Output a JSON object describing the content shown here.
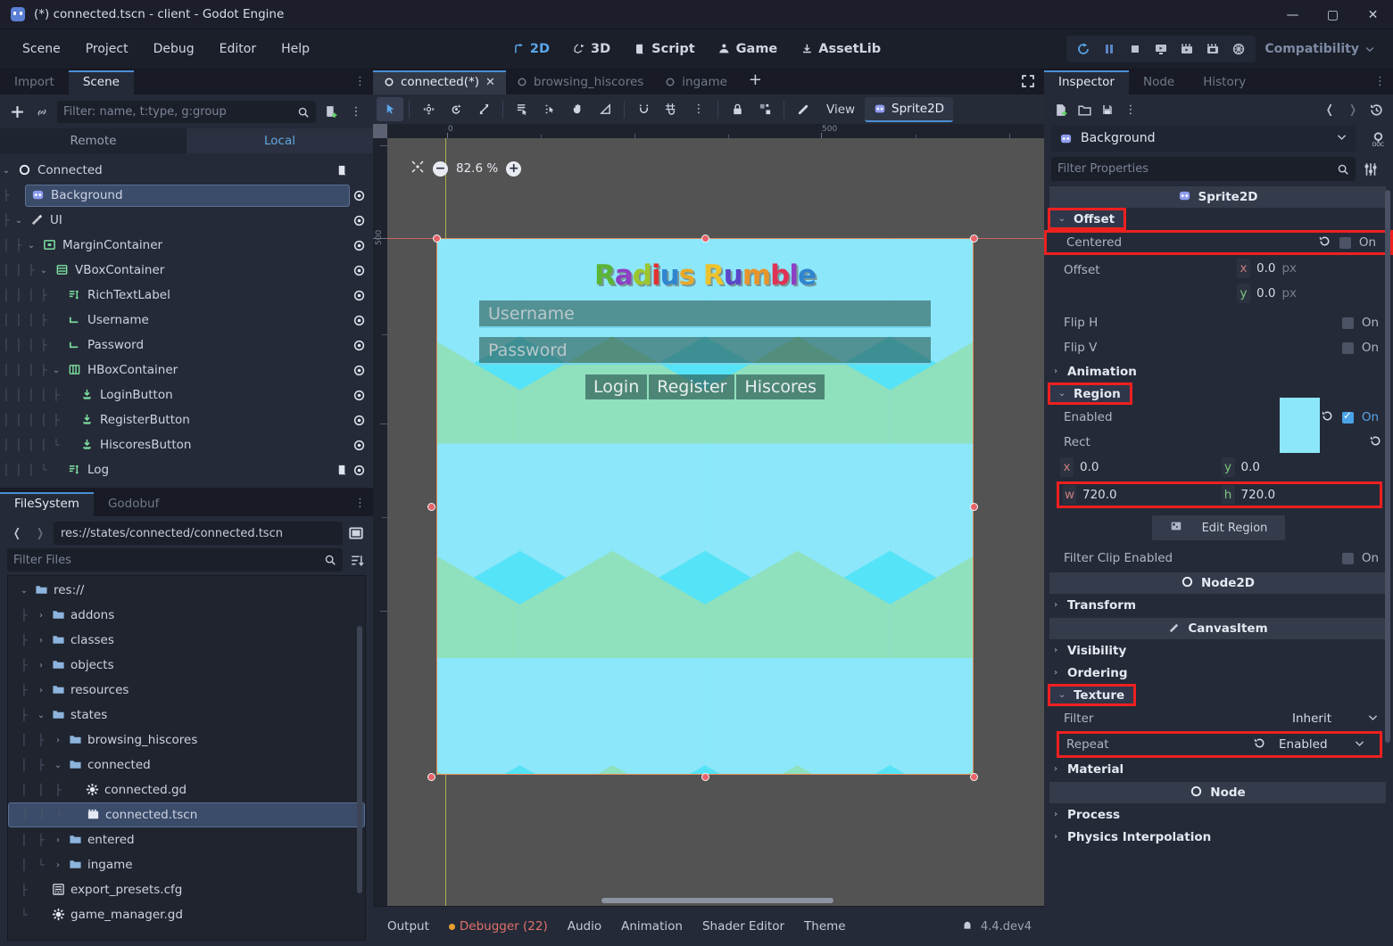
{
  "window": {
    "title": "(*) connected.tscn - client - Godot Engine",
    "minimize": "—",
    "maximize": "▢",
    "close": "✕"
  },
  "menubar": {
    "items": [
      "Scene",
      "Project",
      "Debug",
      "Editor",
      "Help"
    ],
    "main_tabs": [
      {
        "label": "2D",
        "active": true
      },
      {
        "label": "3D",
        "active": false
      },
      {
        "label": "Script",
        "active": false
      },
      {
        "label": "Game",
        "active": false
      },
      {
        "label": "AssetLib",
        "active": false
      }
    ],
    "run_buttons": [
      "run-project-icon",
      "pause-icon",
      "stop-icon",
      "run-current-scene-icon",
      "movie-play-icon",
      "movie-write-icon",
      "remote-debug-icon"
    ],
    "renderer": "Compatibility"
  },
  "left_dock": {
    "tabs": [
      {
        "label": "Import",
        "active": false
      },
      {
        "label": "Scene",
        "active": true
      }
    ],
    "scene": {
      "filter_placeholder": "Filter: name, t:type, g:group",
      "remote_local": [
        {
          "label": "Remote",
          "active": false
        },
        {
          "label": "Local",
          "active": true
        }
      ],
      "tree": [
        {
          "label": "Connected",
          "depth": 0,
          "icon": "node2d-icon",
          "expand": "v",
          "selected": false,
          "script": true,
          "eye": false
        },
        {
          "label": "Background",
          "depth": 1,
          "icon": "sprite2d-icon",
          "expand": "",
          "selected": true,
          "script": false,
          "eye": true
        },
        {
          "label": "UI",
          "depth": 1,
          "icon": "canvaslayer-icon",
          "expand": "v",
          "selected": false,
          "script": false,
          "eye": true
        },
        {
          "label": "MarginContainer",
          "depth": 2,
          "icon": "margincontainer-icon",
          "expand": "v",
          "selected": false,
          "script": false,
          "eye": true
        },
        {
          "label": "VBoxContainer",
          "depth": 3,
          "icon": "vbox-icon",
          "expand": "v",
          "selected": false,
          "script": false,
          "eye": true
        },
        {
          "label": "RichTextLabel",
          "depth": 4,
          "icon": "richtextlabel-icon",
          "expand": "",
          "selected": false,
          "script": false,
          "eye": true
        },
        {
          "label": "Username",
          "depth": 4,
          "icon": "lineedit-icon",
          "expand": "",
          "selected": false,
          "script": false,
          "eye": true
        },
        {
          "label": "Password",
          "depth": 4,
          "icon": "lineedit-icon",
          "expand": "",
          "selected": false,
          "script": false,
          "eye": true
        },
        {
          "label": "HBoxContainer",
          "depth": 4,
          "icon": "hbox-icon",
          "expand": "v",
          "selected": false,
          "script": false,
          "eye": true
        },
        {
          "label": "LoginButton",
          "depth": 5,
          "icon": "button-icon",
          "expand": "",
          "selected": false,
          "script": false,
          "eye": true
        },
        {
          "label": "RegisterButton",
          "depth": 5,
          "icon": "button-icon",
          "expand": "",
          "selected": false,
          "script": false,
          "eye": true
        },
        {
          "label": "HiscoresButton",
          "depth": 5,
          "icon": "button-icon",
          "expand": "",
          "selected": false,
          "script": false,
          "eye": true
        },
        {
          "label": "Log",
          "depth": 4,
          "icon": "richtextlabel-icon",
          "expand": "",
          "selected": false,
          "script": true,
          "eye": true
        }
      ]
    },
    "filesystem": {
      "tabs": [
        {
          "label": "FileSystem",
          "active": true
        },
        {
          "label": "Godobuf",
          "active": false
        }
      ],
      "path": "res://states/connected/connected.tscn",
      "filter_placeholder": "Filter Files",
      "entries": [
        {
          "label": "res://",
          "depth": 0,
          "kind": "folder",
          "expand": "v",
          "selected": false
        },
        {
          "label": "addons",
          "depth": 1,
          "kind": "folder",
          "expand": ">",
          "selected": false
        },
        {
          "label": "classes",
          "depth": 1,
          "kind": "folder",
          "expand": ">",
          "selected": false
        },
        {
          "label": "objects",
          "depth": 1,
          "kind": "folder",
          "expand": ">",
          "selected": false
        },
        {
          "label": "resources",
          "depth": 1,
          "kind": "folder",
          "expand": ">",
          "selected": false
        },
        {
          "label": "states",
          "depth": 1,
          "kind": "folder",
          "expand": "v",
          "selected": false
        },
        {
          "label": "browsing_hiscores",
          "depth": 2,
          "kind": "folder",
          "expand": ">",
          "selected": false
        },
        {
          "label": "connected",
          "depth": 2,
          "kind": "folder",
          "expand": "v",
          "selected": false
        },
        {
          "label": "connected.gd",
          "depth": 3,
          "kind": "script",
          "expand": "",
          "selected": false
        },
        {
          "label": "connected.tscn",
          "depth": 3,
          "kind": "scene",
          "expand": "",
          "selected": true
        },
        {
          "label": "entered",
          "depth": 2,
          "kind": "folder",
          "expand": ">",
          "selected": false
        },
        {
          "label": "ingame",
          "depth": 2,
          "kind": "folder",
          "expand": ">",
          "selected": false
        },
        {
          "label": "export_presets.cfg",
          "depth": 1,
          "kind": "cfg",
          "expand": "",
          "selected": false
        },
        {
          "label": "game_manager.gd",
          "depth": 1,
          "kind": "script",
          "expand": "",
          "selected": false
        }
      ]
    }
  },
  "center": {
    "scene_tabs": [
      {
        "label": "connected(*)",
        "active": true,
        "closable": true
      },
      {
        "label": "browsing_hiscores",
        "active": false,
        "closable": false
      },
      {
        "label": "ingame",
        "active": false,
        "closable": false
      }
    ],
    "add_tab": "+",
    "toolbar": {
      "tools": [
        "select-icon",
        "move-icon",
        "rotate-icon",
        "scale-icon",
        "list-select-icon",
        "ruler-pivot-icon",
        "pan-icon",
        "ruler-icon",
        "snap-magnet-icon",
        "grid-snap-icon",
        "snap-options-icon",
        "lock-icon",
        "group-icon",
        "skeleton-icon"
      ],
      "view_label": "View",
      "node_label": "Sprite2D"
    },
    "ruler": {
      "h_ticks": [
        "0",
        "500"
      ],
      "v_ticks": [
        "500"
      ]
    },
    "zoom": "82.6 %",
    "zoom_minus": "−",
    "zoom_plus": "+",
    "game": {
      "title_letters": [
        {
          "ch": "R",
          "color": "#5bb535"
        },
        {
          "ch": "a",
          "color": "#8e3fc4"
        },
        {
          "ch": "d",
          "color": "#9dc62e"
        },
        {
          "ch": "i",
          "color": "#e03232"
        },
        {
          "ch": "u",
          "color": "#2f85cf"
        },
        {
          "ch": "s",
          "color": "#e8a92a"
        },
        {
          "ch": " ",
          "color": "#ffffff"
        },
        {
          "ch": "R",
          "color": "#ecc32b"
        },
        {
          "ch": "u",
          "color": "#5b46c9"
        },
        {
          "ch": "m",
          "color": "#e8942a"
        },
        {
          "ch": "b",
          "color": "#e03255"
        },
        {
          "ch": "l",
          "color": "#8e3fc4"
        },
        {
          "ch": "e",
          "color": "#2f85cf"
        }
      ],
      "username_placeholder": "Username",
      "password_placeholder": "Password",
      "buttons": [
        "Login",
        "Register",
        "Hiscores"
      ]
    }
  },
  "bottom_bar": {
    "items": [
      {
        "label": "Output",
        "alert": false
      },
      {
        "label": "Debugger (22)",
        "alert": true
      },
      {
        "label": "Audio",
        "alert": false
      },
      {
        "label": "Animation",
        "alert": false
      },
      {
        "label": "Shader Editor",
        "alert": false
      },
      {
        "label": "Theme",
        "alert": false
      }
    ],
    "version": "4.4.dev4"
  },
  "inspector": {
    "tabs": [
      {
        "label": "Inspector",
        "active": true
      },
      {
        "label": "Node",
        "active": false
      },
      {
        "label": "History",
        "active": false
      }
    ],
    "toolbar_icons": [
      "new-resource-icon",
      "open-resource-icon",
      "save-resource-icon",
      "resource-menu-icon",
      "history-back-icon",
      "history-forward-icon",
      "history-icon"
    ],
    "object_name": "Background",
    "doc_icon": "open-docs-icon",
    "filter_placeholder": "Filter Properties",
    "filter_settings_icon": "object-settings-icon",
    "rows": [
      {
        "type": "category",
        "label": "Sprite2D",
        "icon": "sprite2d-icon"
      },
      {
        "type": "texture",
        "label": "Texture",
        "revert": true,
        "preview": true
      },
      {
        "type": "group",
        "label": "Offset",
        "open": true,
        "highlight": true
      },
      {
        "type": "bool",
        "label": "Centered",
        "value": "On",
        "checked": false,
        "revert": true,
        "highlight": true
      },
      {
        "type": "vec2px",
        "label": "Offset",
        "x": "0.0",
        "y": "0.0",
        "unit": "px"
      },
      {
        "type": "bool",
        "label": "Flip H",
        "value": "On",
        "checked": false,
        "revert": false
      },
      {
        "type": "bool",
        "label": "Flip V",
        "value": "On",
        "checked": false,
        "revert": false
      },
      {
        "type": "group",
        "label": "Animation",
        "open": false
      },
      {
        "type": "group",
        "label": "Region",
        "open": true,
        "highlight": true
      },
      {
        "type": "bool",
        "label": "Enabled",
        "value": "On",
        "checked": true,
        "revert": true
      },
      {
        "type": "rect",
        "label": "Rect",
        "x": "0.0",
        "y": "0.0",
        "w": "720.0",
        "h": "720.0"
      },
      {
        "type": "button",
        "label": "Edit Region",
        "icon": "edit-region-icon"
      },
      {
        "type": "bool",
        "label": "Filter Clip Enabled",
        "value": "On",
        "checked": false,
        "revert": false
      },
      {
        "type": "category",
        "label": "Node2D",
        "icon": "node2d-icon"
      },
      {
        "type": "group",
        "label": "Transform",
        "open": false
      },
      {
        "type": "category",
        "label": "CanvasItem",
        "icon": "canvasitem-icon"
      },
      {
        "type": "group",
        "label": "Visibility",
        "open": false
      },
      {
        "type": "group",
        "label": "Ordering",
        "open": false
      },
      {
        "type": "group",
        "label": "Texture",
        "open": true,
        "highlight": true
      },
      {
        "type": "enum",
        "label": "Filter",
        "value": "Inherit",
        "revert": false
      },
      {
        "type": "enum",
        "label": "Repeat",
        "value": "Enabled",
        "revert": true,
        "highlight": true
      },
      {
        "type": "group",
        "label": "Material",
        "open": false
      },
      {
        "type": "category",
        "label": "Node",
        "icon": "node-icon"
      },
      {
        "type": "group",
        "label": "Process",
        "open": false
      },
      {
        "type": "group",
        "label": "Physics Interpolation",
        "open": false
      }
    ]
  }
}
